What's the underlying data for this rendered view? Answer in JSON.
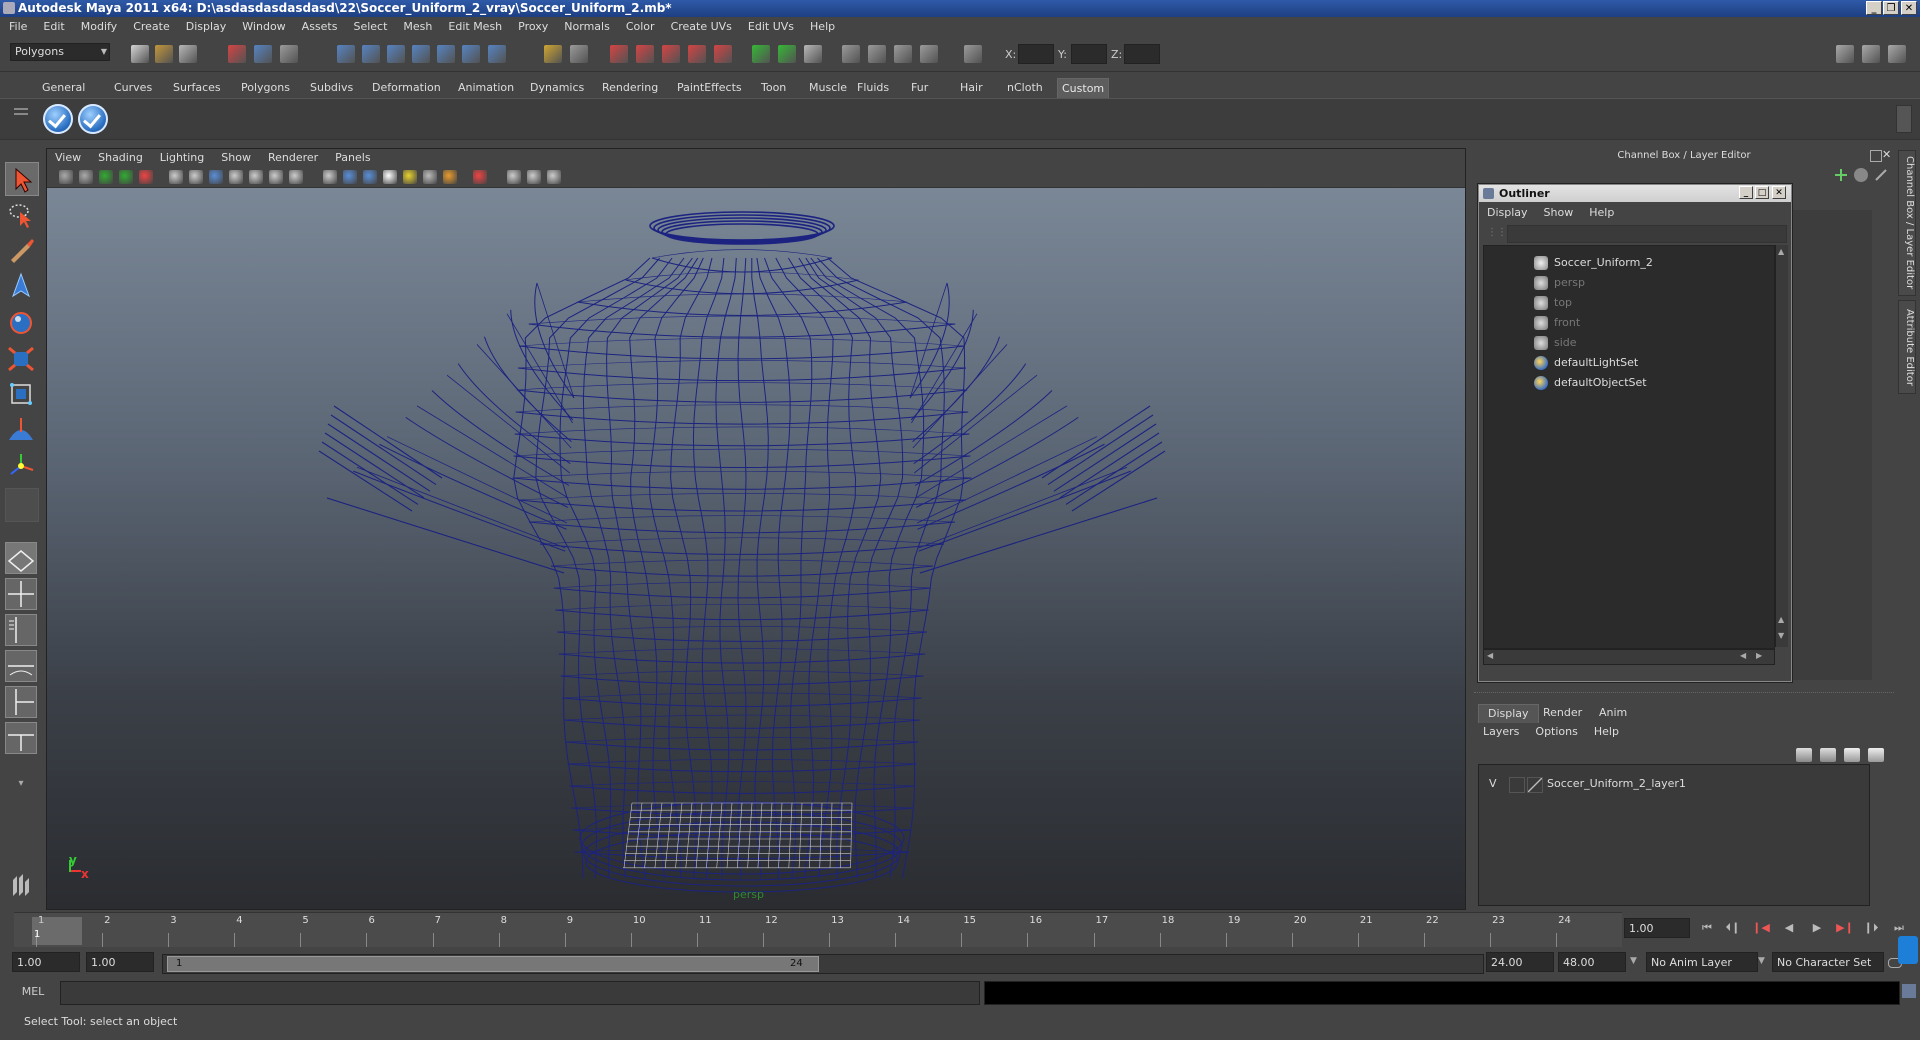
{
  "window": {
    "title": "Autodesk Maya 2011 x64: D:\\asdasdasdasdasd\\22\\Soccer_Uniform_2_vray\\Soccer_Uniform_2.mb*"
  },
  "menubar": [
    "File",
    "Edit",
    "Modify",
    "Create",
    "Display",
    "Window",
    "Assets",
    "Select",
    "Mesh",
    "Edit Mesh",
    "Proxy",
    "Normals",
    "Color",
    "Create UVs",
    "Edit UVs",
    "Help"
  ],
  "statusline": {
    "menuset": "Polygons",
    "x_label": "X:",
    "y_label": "Y:",
    "z_label": "Z:"
  },
  "shelf": {
    "tabs": [
      "General",
      "Curves",
      "Surfaces",
      "Polygons",
      "Subdivs",
      "Deformation",
      "Animation",
      "Dynamics",
      "Rendering",
      "PaintEffects",
      "Toon",
      "Muscle",
      "Fluids",
      "Fur",
      "Hair",
      "nCloth",
      "Custom"
    ],
    "active_tab": "Custom"
  },
  "viewport": {
    "menu": [
      "View",
      "Shading",
      "Lighting",
      "Show",
      "Renderer",
      "Panels"
    ],
    "camera_label": "persp",
    "axis_y": "y",
    "axis_x": "x"
  },
  "channelbox": {
    "header": "Channel Box / Layer Editor"
  },
  "outliner": {
    "title": "Outliner",
    "menu": [
      "Display",
      "Show",
      "Help"
    ],
    "items": [
      {
        "label": "Soccer_Uniform_2",
        "type": "group",
        "dim": false
      },
      {
        "label": "persp",
        "type": "camera",
        "dim": true
      },
      {
        "label": "top",
        "type": "camera",
        "dim": true
      },
      {
        "label": "front",
        "type": "camera",
        "dim": true
      },
      {
        "label": "side",
        "type": "camera",
        "dim": true
      },
      {
        "label": "defaultLightSet",
        "type": "set",
        "dim": false
      },
      {
        "label": "defaultObjectSet",
        "type": "set",
        "dim": false
      }
    ]
  },
  "layer_editor": {
    "tabs": [
      "Display",
      "Render",
      "Anim"
    ],
    "active_tab": "Display",
    "menu": [
      "Layers",
      "Options",
      "Help"
    ],
    "layers": [
      {
        "visible": "V",
        "name": "Soccer_Uniform_2_layer1"
      }
    ]
  },
  "side_tabs": [
    "Channel Box / Layer Editor",
    "Attribute Editor"
  ],
  "timeline": {
    "start": 1,
    "end": 24,
    "current_frame": "1.00",
    "current_marker": "1"
  },
  "range": {
    "start_time": "1.00",
    "playback_start": "1.00",
    "slider_start": "1",
    "slider_end": "24",
    "playback_end": "24.00",
    "end_time": "48.00",
    "anim_layer": "No Anim Layer",
    "character_set": "No Character Set"
  },
  "command": {
    "label": "MEL"
  },
  "helpline": {
    "text": "Select Tool: select an object"
  },
  "colors": {
    "wireframe": "#1c2380",
    "background_top": "#7a8796",
    "background_bottom": "#2a2c30"
  }
}
